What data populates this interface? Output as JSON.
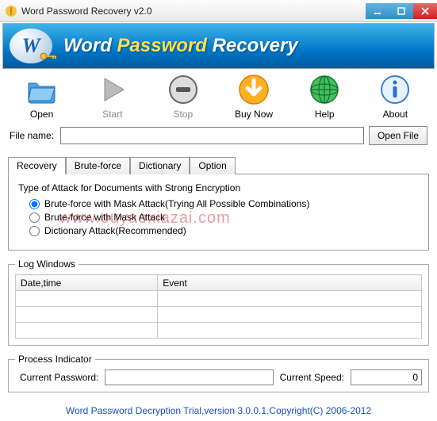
{
  "window": {
    "title": "Word Password Recovery v2.0"
  },
  "banner": {
    "word": "Word ",
    "password": "Password ",
    "recovery": "Recovery"
  },
  "toolbar": {
    "open": "Open",
    "start": "Start",
    "stop": "Stop",
    "buynow": "Buy Now",
    "help": "Help",
    "about": "About"
  },
  "filerow": {
    "label": "File name:",
    "value": "",
    "open_btn": "Open File"
  },
  "tabs": {
    "recovery": "Recovery",
    "bruteforce": "Brute-force",
    "dictionary": "Dictionary",
    "option": "Option"
  },
  "attack": {
    "title": "Type of Attack for Documents with Strong Encryption",
    "opt1": "Brute-force with Mask Attack(Trying All Possible Combinations)",
    "opt2": "Brute-force with Mask Attack",
    "opt3": "Dictionary Attack(Recommended)"
  },
  "watermark": "www.ouyaoxiazai.com",
  "log": {
    "legend": "Log Windows",
    "col_date": "Date,time",
    "col_event": "Event"
  },
  "process": {
    "legend": "Process Indicator",
    "cur_pwd_label": "Current Password:",
    "cur_pwd_value": "",
    "cur_speed_label": "Current Speed:",
    "cur_speed_value": "0"
  },
  "footer": "Word Password Decryption Trial,version 3.0.0.1.Copyright(C) 2006-2012"
}
